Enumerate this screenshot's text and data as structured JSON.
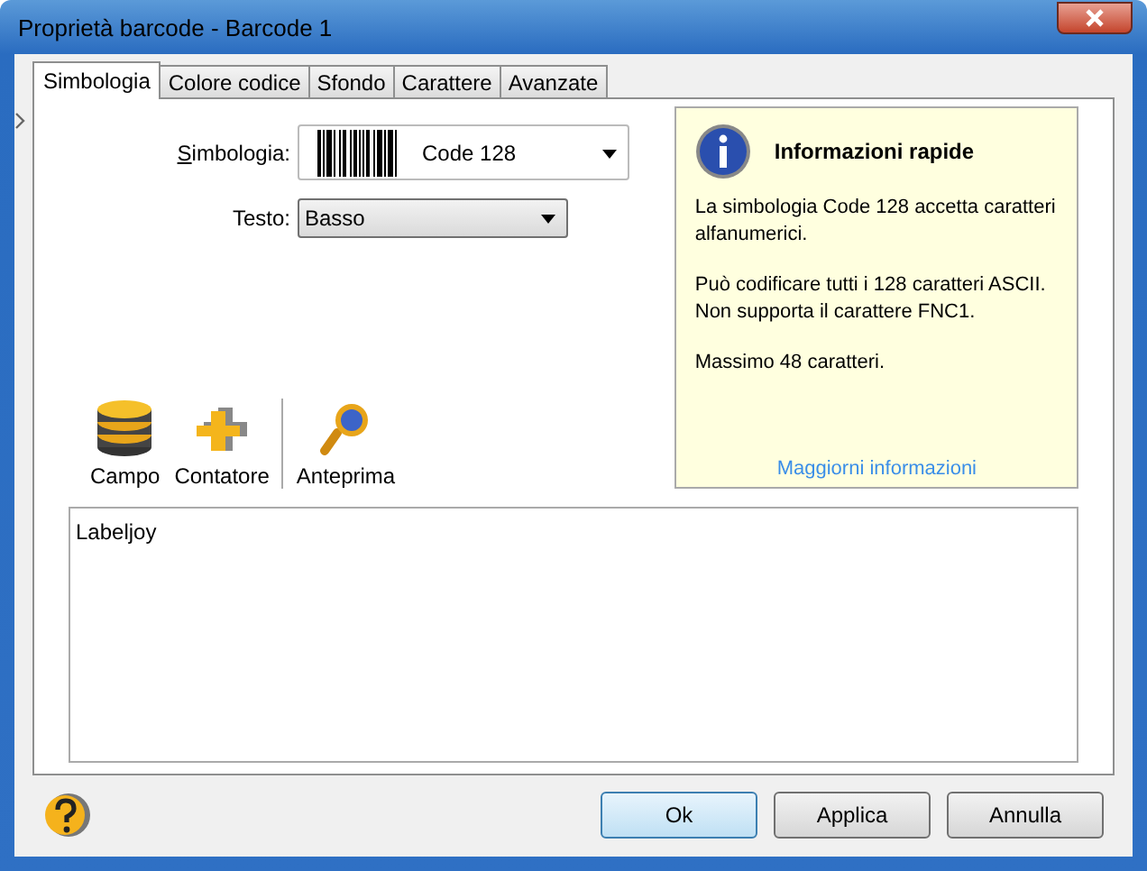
{
  "window": {
    "title": "Proprietà barcode - Barcode 1"
  },
  "tabs": [
    {
      "label": "Simbologia",
      "selected": true
    },
    {
      "label": "Colore codice",
      "selected": false
    },
    {
      "label": "Sfondo",
      "selected": false
    },
    {
      "label": "Carattere",
      "selected": false
    },
    {
      "label": "Avanzate",
      "selected": false
    }
  ],
  "symbology": {
    "label": "Simbologia:",
    "value": "Code 128"
  },
  "text_position": {
    "label": "Testo:",
    "value": "Basso"
  },
  "toolbar": [
    {
      "kind": "database",
      "label": "Campo"
    },
    {
      "kind": "counter",
      "label": "Contatore"
    },
    {
      "kind": "preview",
      "label": "Anteprima"
    }
  ],
  "info": {
    "title": "Informazioni rapide",
    "paragraphs": [
      "La simbologia Code 128 accetta caratteri alfanumerici.",
      "Può codificare tutti i 128 caratteri ASCII. Non supporta il carattere FNC1.",
      "Massimo 48 caratteri."
    ],
    "link": "Maggiorni informazioni"
  },
  "content": {
    "value": "Labeljoy"
  },
  "buttons": [
    {
      "label": "Ok",
      "default": true
    },
    {
      "label": "Applica",
      "default": false
    },
    {
      "label": "Annulla",
      "default": false
    }
  ]
}
